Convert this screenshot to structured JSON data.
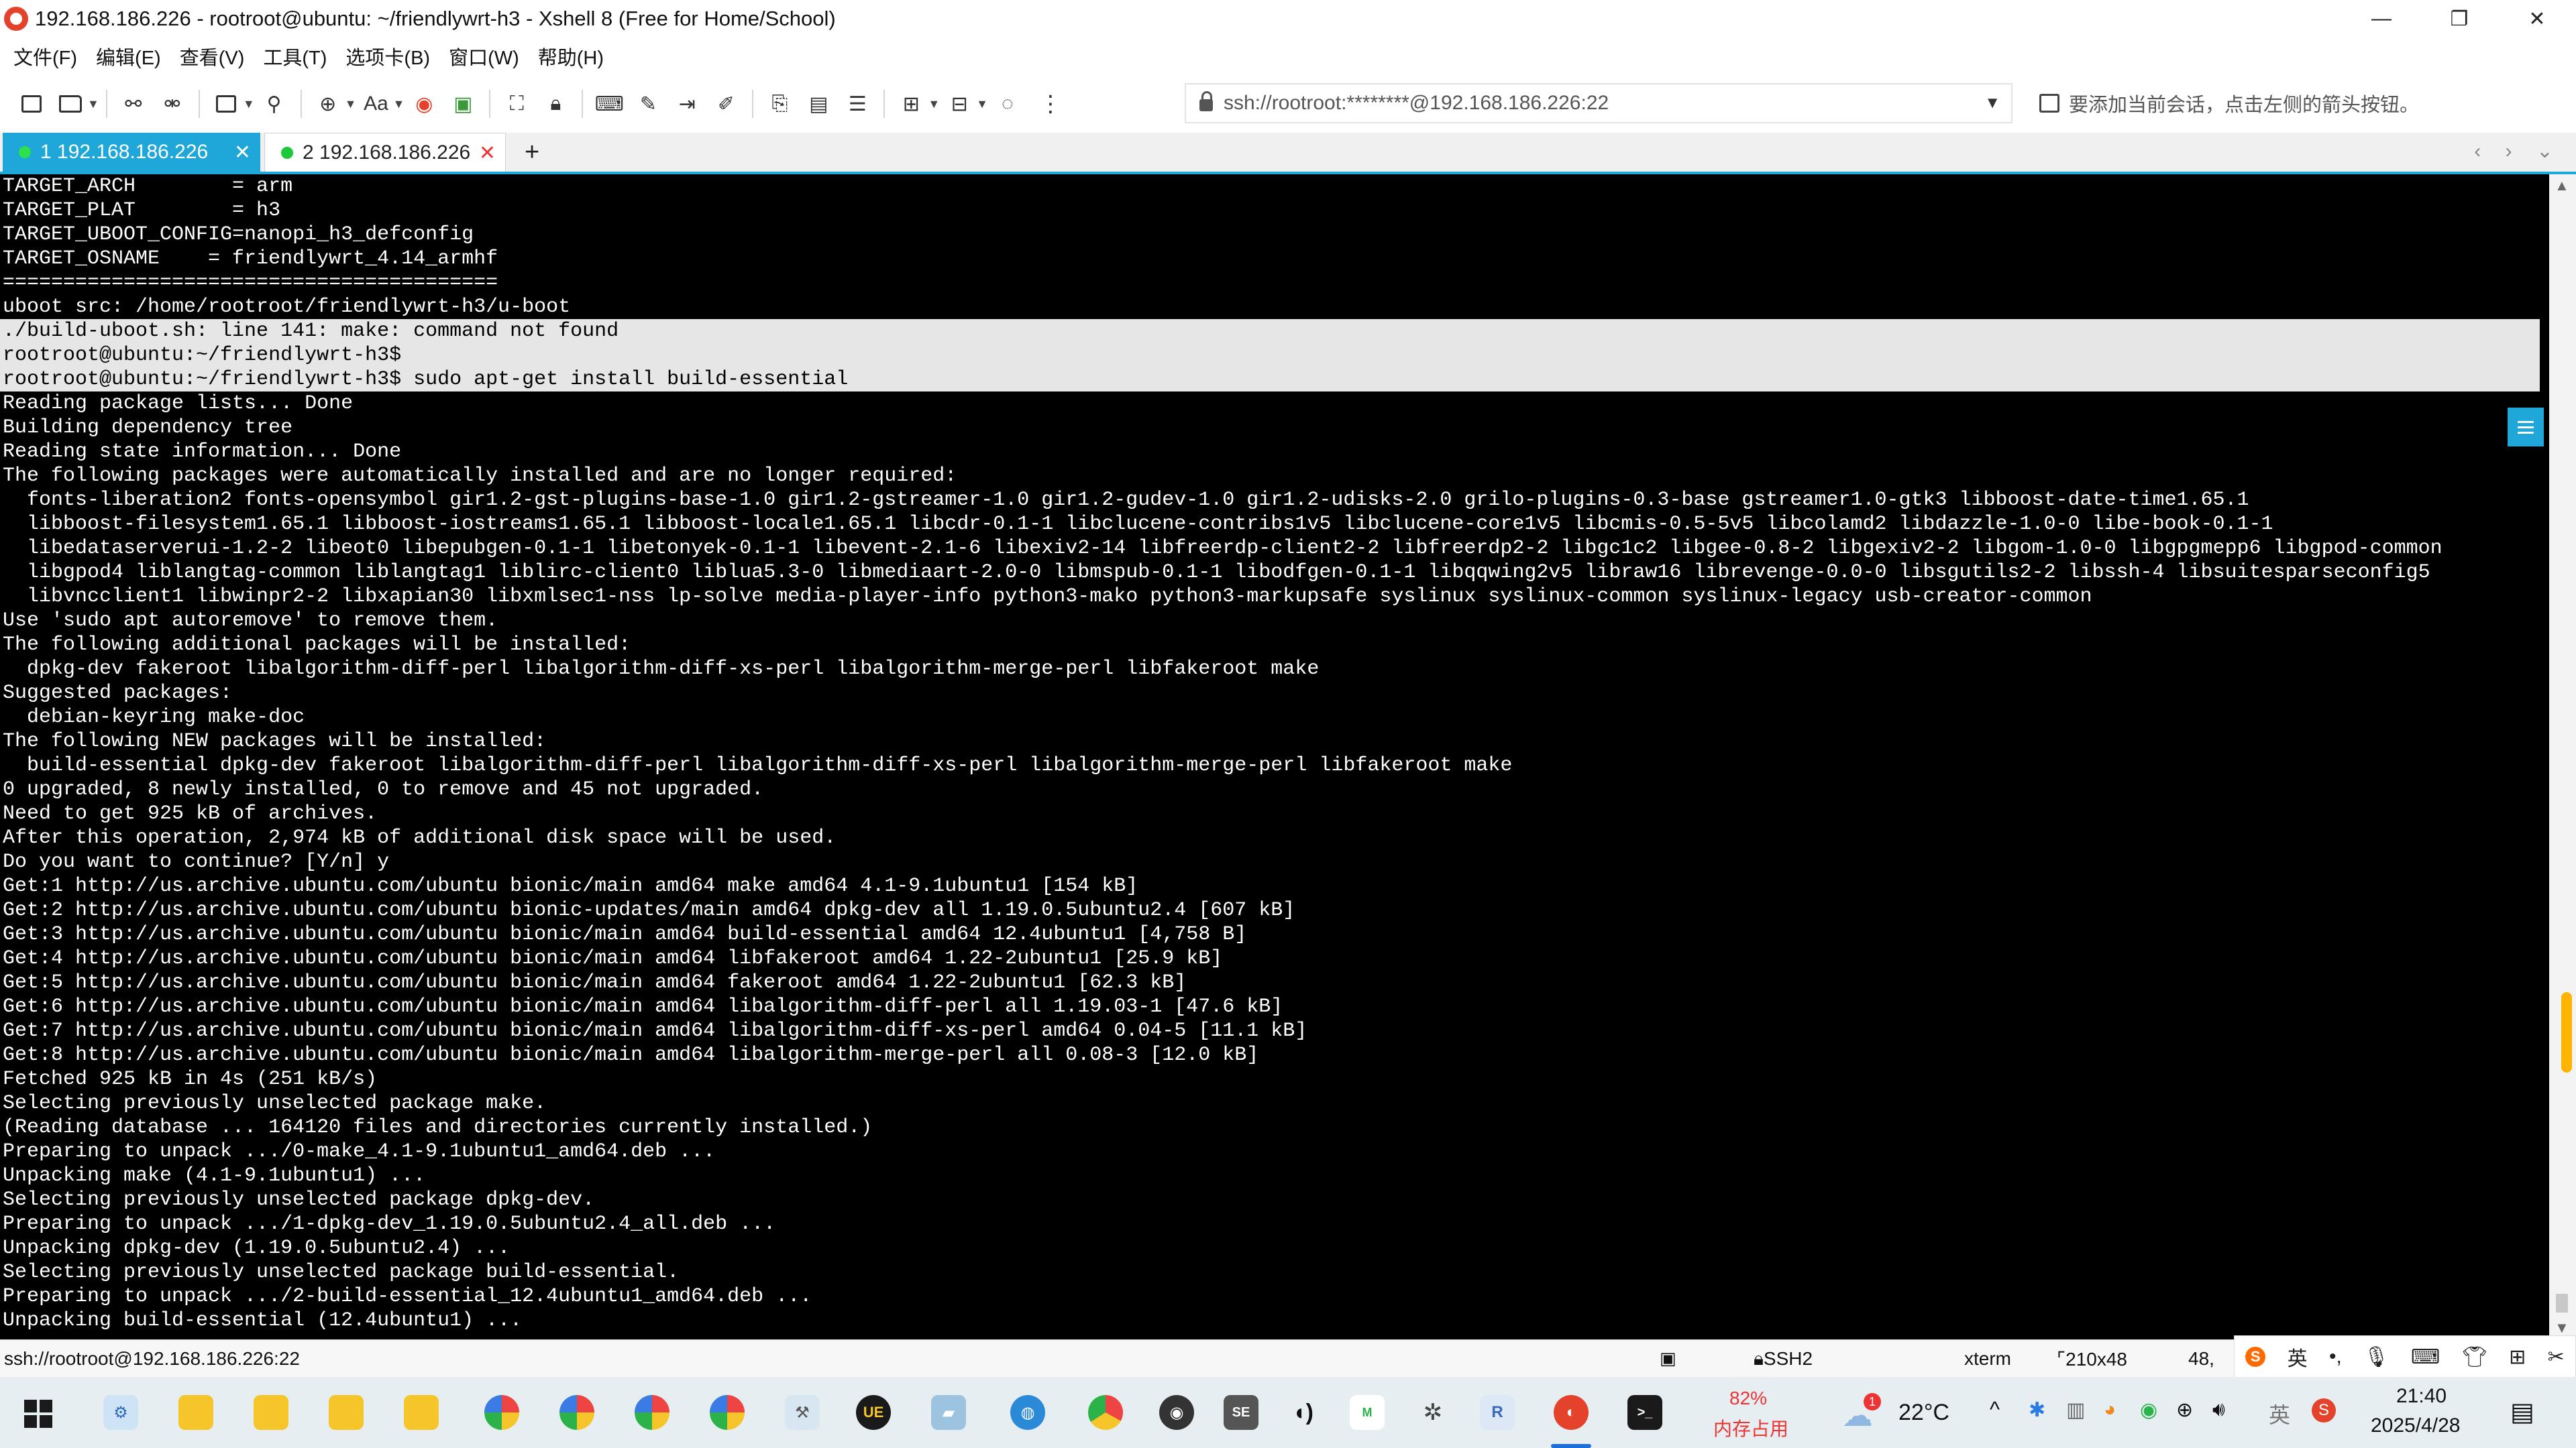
{
  "window": {
    "title": "192.168.186.226 - rootroot@ubuntu: ~/friendlywrt-h3 - Xshell 8 (Free for Home/School)",
    "controls": {
      "minimize": "—",
      "restore": "❐",
      "close": "✕"
    }
  },
  "menu": [
    "文件(F)",
    "编辑(E)",
    "查看(V)",
    "工具(T)",
    "选项卡(B)",
    "窗口(W)",
    "帮助(H)"
  ],
  "toolbar": {
    "font_label": "Aa",
    "address": "ssh://rootroot:********@192.168.186.226:22",
    "hint": "要添加当前会话，点击左侧的箭头按钮。"
  },
  "tabs": [
    {
      "label": "1 192.168.186.226",
      "active": true
    },
    {
      "label": "2 192.168.186.226",
      "active": false
    }
  ],
  "tab_controls": {
    "add": "+",
    "close": "✕",
    "nav": "‹ › ⌄"
  },
  "terminal": {
    "lines": [
      {
        "text": "TARGET_ARCH        = arm",
        "hl": false
      },
      {
        "text": "TARGET_PLAT        = h3",
        "hl": false
      },
      {
        "text": "TARGET_UBOOT_CONFIG=nanopi_h3_defconfig",
        "hl": false
      },
      {
        "text": "TARGET_OSNAME    = friendlywrt_4.14_armhf",
        "hl": false
      },
      {
        "text": "=========================================",
        "hl": false
      },
      {
        "text": "uboot src: /home/rootroot/friendlywrt-h3/u-boot",
        "hl": false
      },
      {
        "text": "./build-uboot.sh: line 141: make: command not found",
        "hl": true
      },
      {
        "text": "rootroot@ubuntu:~/friendlywrt-h3$",
        "hl": true
      },
      {
        "text": "rootroot@ubuntu:~/friendlywrt-h3$ sudo apt-get install build-essential",
        "hl": true
      },
      {
        "text": "Reading package lists... Done",
        "hl": false
      },
      {
        "text": "Building dependency tree",
        "hl": false
      },
      {
        "text": "Reading state information... Done",
        "hl": false
      },
      {
        "text": "The following packages were automatically installed and are no longer required:",
        "hl": false
      },
      {
        "text": "  fonts-liberation2 fonts-opensymbol gir1.2-gst-plugins-base-1.0 gir1.2-gstreamer-1.0 gir1.2-gudev-1.0 gir1.2-udisks-2.0 grilo-plugins-0.3-base gstreamer1.0-gtk3 libboost-date-time1.65.1",
        "hl": false
      },
      {
        "text": "  libboost-filesystem1.65.1 libboost-iostreams1.65.1 libboost-locale1.65.1 libcdr-0.1-1 libclucene-contribs1v5 libclucene-core1v5 libcmis-0.5-5v5 libcolamd2 libdazzle-1.0-0 libe-book-0.1-1",
        "hl": false
      },
      {
        "text": "  libedataserverui-1.2-2 libeot0 libepubgen-0.1-1 libetonyek-0.1-1 libevent-2.1-6 libexiv2-14 libfreerdp-client2-2 libfreerdp2-2 libgc1c2 libgee-0.8-2 libgexiv2-2 libgom-1.0-0 libgpgmepp6 libgpod-common",
        "hl": false
      },
      {
        "text": "  libgpod4 liblangtag-common liblangtag1 liblirc-client0 liblua5.3-0 libmediaart-2.0-0 libmspub-0.1-1 libodfgen-0.1-1 libqqwing2v5 libraw16 librevenge-0.0-0 libsgutils2-2 libssh-4 libsuitesparseconfig5",
        "hl": false
      },
      {
        "text": "  libvncclient1 libwinpr2-2 libxapian30 libxmlsec1-nss lp-solve media-player-info python3-mako python3-markupsafe syslinux syslinux-common syslinux-legacy usb-creator-common",
        "hl": false
      },
      {
        "text": "Use 'sudo apt autoremove' to remove them.",
        "hl": false
      },
      {
        "text": "The following additional packages will be installed:",
        "hl": false
      },
      {
        "text": "  dpkg-dev fakeroot libalgorithm-diff-perl libalgorithm-diff-xs-perl libalgorithm-merge-perl libfakeroot make",
        "hl": false
      },
      {
        "text": "Suggested packages:",
        "hl": false
      },
      {
        "text": "  debian-keyring make-doc",
        "hl": false
      },
      {
        "text": "The following NEW packages will be installed:",
        "hl": false
      },
      {
        "text": "  build-essential dpkg-dev fakeroot libalgorithm-diff-perl libalgorithm-diff-xs-perl libalgorithm-merge-perl libfakeroot make",
        "hl": false
      },
      {
        "text": "0 upgraded, 8 newly installed, 0 to remove and 45 not upgraded.",
        "hl": false
      },
      {
        "text": "Need to get 925 kB of archives.",
        "hl": false
      },
      {
        "text": "After this operation, 2,974 kB of additional disk space will be used.",
        "hl": false
      },
      {
        "text": "Do you want to continue? [Y/n] y",
        "hl": false
      },
      {
        "text": "Get:1 http://us.archive.ubuntu.com/ubuntu bionic/main amd64 make amd64 4.1-9.1ubuntu1 [154 kB]",
        "hl": false
      },
      {
        "text": "Get:2 http://us.archive.ubuntu.com/ubuntu bionic-updates/main amd64 dpkg-dev all 1.19.0.5ubuntu2.4 [607 kB]",
        "hl": false
      },
      {
        "text": "Get:3 http://us.archive.ubuntu.com/ubuntu bionic/main amd64 build-essential amd64 12.4ubuntu1 [4,758 B]",
        "hl": false
      },
      {
        "text": "Get:4 http://us.archive.ubuntu.com/ubuntu bionic/main amd64 libfakeroot amd64 1.22-2ubuntu1 [25.9 kB]",
        "hl": false
      },
      {
        "text": "Get:5 http://us.archive.ubuntu.com/ubuntu bionic/main amd64 fakeroot amd64 1.22-2ubuntu1 [62.3 kB]",
        "hl": false
      },
      {
        "text": "Get:6 http://us.archive.ubuntu.com/ubuntu bionic/main amd64 libalgorithm-diff-perl all 1.19.03-1 [47.6 kB]",
        "hl": false
      },
      {
        "text": "Get:7 http://us.archive.ubuntu.com/ubuntu bionic/main amd64 libalgorithm-diff-xs-perl amd64 0.04-5 [11.1 kB]",
        "hl": false
      },
      {
        "text": "Get:8 http://us.archive.ubuntu.com/ubuntu bionic/main amd64 libalgorithm-merge-perl all 0.08-3 [12.0 kB]",
        "hl": false
      },
      {
        "text": "Fetched 925 kB in 4s (251 kB/s)",
        "hl": false
      },
      {
        "text": "Selecting previously unselected package make.",
        "hl": false
      },
      {
        "text": "(Reading database ... 164120 files and directories currently installed.)",
        "hl": false
      },
      {
        "text": "Preparing to unpack .../0-make_4.1-9.1ubuntu1_amd64.deb ...",
        "hl": false
      },
      {
        "text": "Unpacking make (4.1-9.1ubuntu1) ...",
        "hl": false
      },
      {
        "text": "Selecting previously unselected package dpkg-dev.",
        "hl": false
      },
      {
        "text": "Preparing to unpack .../1-dpkg-dev_1.19.0.5ubuntu2.4_all.deb ...",
        "hl": false
      },
      {
        "text": "Unpacking dpkg-dev (1.19.0.5ubuntu2.4) ...",
        "hl": false
      },
      {
        "text": "Selecting previously unselected package build-essential.",
        "hl": false
      },
      {
        "text": "Preparing to unpack .../2-build-essential_12.4ubuntu1_amd64.deb ...",
        "hl": false
      },
      {
        "text": "Unpacking build-essential (12.4ubuntu1) ...",
        "hl": false
      }
    ]
  },
  "statusbar": {
    "session": "ssh://rootroot@192.168.186.226:22",
    "protocol": "SSH2",
    "terminal_type": "xterm",
    "size": "210x48",
    "cursor": "48,"
  },
  "ime": {
    "mode": "英"
  },
  "taskbar": {
    "memory_percent": "82%",
    "memory_label": "内存占用",
    "weather_temp": "22°C",
    "weather_badge": "1",
    "ime_lang": "英",
    "time": "21:40",
    "date": "2025/4/28"
  },
  "colors": {
    "accent": "#1ea7d8",
    "terminal_bg": "#000000",
    "terminal_fg": "#ffffff",
    "highlight_bg": "#e6e6e6",
    "session_dot": "#1aca3a"
  }
}
